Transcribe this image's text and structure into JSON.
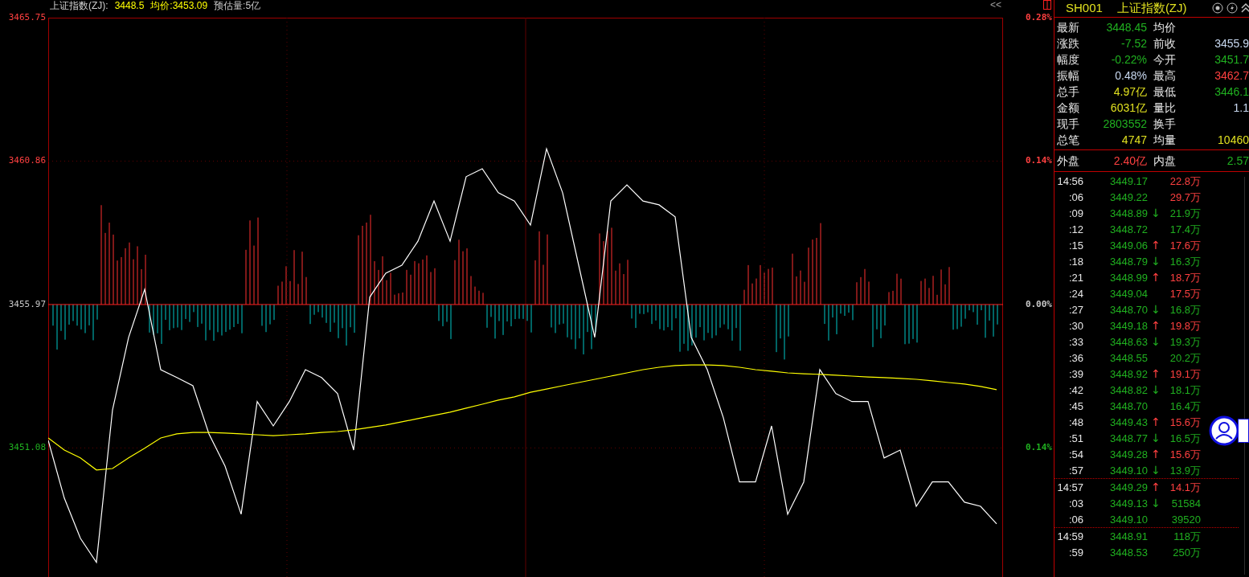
{
  "header": {
    "title": "上证指数(ZJ):",
    "price": "3448.5",
    "average": "均价:3453.09",
    "estimate": "预估量:5亿"
  },
  "collapse_button": "<<",
  "chart": {
    "right_axis": [
      {
        "text": "0.28%",
        "color": "#ff4040"
      },
      {
        "text": "0.14%",
        "color": "#ff4040"
      },
      {
        "text": "0.00%",
        "color": "#c8c8c8"
      },
      {
        "text": "0.14%",
        "color": "#20b020"
      }
    ],
    "chart_data": {
      "type": "line",
      "ylim": [
        3446.68,
        3465.75
      ],
      "grid": true,
      "ref_lines": [
        {
          "axis": "y",
          "value": 3455.97,
          "color": "#ff2020"
        }
      ],
      "categories": [
        null,
        null,
        null,
        null,
        null,
        null,
        null,
        null,
        null,
        null,
        null,
        null,
        null,
        null,
        null,
        null,
        null,
        null,
        null,
        null,
        null,
        null,
        null,
        null,
        null,
        null,
        null,
        null,
        null,
        null,
        null,
        null,
        null,
        null,
        null,
        null,
        null,
        null,
        null,
        null,
        null,
        null,
        null,
        null,
        null,
        null,
        null,
        null,
        null,
        null,
        null,
        null,
        null,
        null,
        null,
        null,
        null,
        null,
        null,
        null
      ],
      "yticks": [
        {
          "value": 3465.75,
          "label": "3465.75"
        },
        {
          "value": 3460.86,
          "label": "3460.86"
        },
        {
          "value": 3455.97,
          "label": "3455.97"
        },
        {
          "value": 3451.08,
          "label": "3451.08"
        }
      ],
      "series": [
        {
          "color": "#ffffff",
          "values": [
            3451.34,
            3449.37,
            3448.0,
            3447.18,
            3452.38,
            3454.85,
            3456.49,
            3453.75,
            3453.48,
            3453.2,
            3451.56,
            3450.46,
            3448.82,
            3452.66,
            3451.83,
            3452.66,
            3453.75,
            3453.48,
            3452.93,
            3451.01,
            3456.22,
            3457.04,
            3457.31,
            3458.13,
            3459.5,
            3458.13,
            3460.33,
            3460.6,
            3459.78,
            3459.5,
            3458.68,
            3461.28,
            3459.78,
            3457.31,
            3454.85,
            3459.5,
            3460.05,
            3459.5,
            3459.37,
            3458.96,
            3454.85,
            3453.75,
            3452.11,
            3449.92,
            3449.92,
            3451.83,
            3448.82,
            3449.92,
            3453.75,
            3452.93,
            3452.66,
            3452.66,
            3450.74,
            3451.01,
            3449.09,
            3449.92,
            3449.92,
            3449.23,
            3449.09,
            3448.49
          ]
        },
        {
          "color": "#ffff00",
          "values": [
            3451.42,
            3451.01,
            3450.74,
            3450.33,
            3450.38,
            3450.74,
            3451.07,
            3451.42,
            3451.56,
            3451.61,
            3451.61,
            3451.59,
            3451.56,
            3451.53,
            3451.5,
            3451.53,
            3451.56,
            3451.61,
            3451.64,
            3451.7,
            3451.78,
            3451.86,
            3451.97,
            3452.08,
            3452.19,
            3452.3,
            3452.44,
            3452.57,
            3452.71,
            3452.82,
            3452.98,
            3453.09,
            3453.2,
            3453.31,
            3453.42,
            3453.53,
            3453.64,
            3453.75,
            3453.83,
            3453.89,
            3453.91,
            3453.91,
            3453.89,
            3453.83,
            3453.75,
            3453.7,
            3453.64,
            3453.61,
            3453.59,
            3453.56,
            3453.53,
            3453.5,
            3453.48,
            3453.45,
            3453.42,
            3453.37,
            3453.31,
            3453.26,
            3453.18,
            3453.07
          ]
        }
      ]
    }
  },
  "panel": {
    "code": "SH001",
    "name": "上证指数(ZJ)",
    "quote": [
      {
        "left": {
          "label": "最新",
          "value": "3448.45",
          "color": "#20b020"
        },
        "right": {
          "label": "均价"
        }
      },
      {
        "left": {
          "label": "涨跌",
          "value": "-7.52",
          "color": "#20b020"
        },
        "right": {
          "label": "前收",
          "value": "3455.9",
          "color": "#c8d8f0"
        }
      },
      {
        "left": {
          "label": "幅度",
          "value": "-0.22%",
          "color": "#20b020"
        },
        "right": {
          "label": "今开",
          "value": "3451.7",
          "color": "#20b020"
        }
      },
      {
        "left": {
          "label": "振幅",
          "value": "0.48%",
          "color": "#c8d8f0"
        },
        "right": {
          "label": "最高",
          "value": "3462.7",
          "color": "#ff4040"
        }
      },
      {
        "left": {
          "label": "总手",
          "value": "4.97亿",
          "color": "#e0e020"
        },
        "right": {
          "label": "最低",
          "value": "3446.1",
          "color": "#20b020"
        }
      },
      {
        "left": {
          "label": "金额",
          "value": "6031亿",
          "color": "#e0e020"
        },
        "right": {
          "label": "量比",
          "value": "1.1",
          "color": "#c8d8f0"
        }
      },
      {
        "left": {
          "label": "现手",
          "value": "2803552",
          "color": "#20b020"
        },
        "right": {
          "label": "换手"
        }
      },
      {
        "left": {
          "label": "总笔",
          "value": "4747",
          "color": "#e0e020"
        },
        "right": {
          "label": "均量",
          "value": "10460",
          "color": "#e0e020"
        }
      }
    ],
    "balance": {
      "left": {
        "label": "外盘",
        "value": "2.40亿",
        "color": "#ff4040"
      },
      "right": {
        "label": "内盘",
        "value": "2.57",
        "color": "#20b020"
      }
    },
    "tick_groups": [
      {
        "rows": [
          {
            "time": "14:56",
            "price": "3449.17",
            "kind": "plain",
            "volume": "22.8万",
            "color": "#ff4040"
          },
          {
            "time": ":06",
            "price": "3449.22",
            "kind": "plain",
            "volume": "29.7万",
            "color": "#ff4040"
          },
          {
            "time": ":09",
            "price": "3448.89",
            "arrow": "↓",
            "kind": "down",
            "volume": "21.9万",
            "color": "#20b020"
          },
          {
            "time": ":12",
            "price": "3448.72",
            "kind": "plain",
            "volume": "17.4万",
            "color": "#20b020"
          },
          {
            "time": ":15",
            "price": "3449.06",
            "arrow": "↑",
            "kind": "up",
            "volume": "17.6万",
            "color": "#ff4040"
          },
          {
            "time": ":18",
            "price": "3448.79",
            "arrow": "↓",
            "kind": "down",
            "volume": "16.3万",
            "color": "#20b020"
          },
          {
            "time": ":21",
            "price": "3448.99",
            "arrow": "↑",
            "kind": "up",
            "volume": "18.7万",
            "color": "#ff4040"
          },
          {
            "time": ":24",
            "price": "3449.04",
            "kind": "plain",
            "volume": "17.5万",
            "color": "#ff4040"
          },
          {
            "time": ":27",
            "price": "3448.70",
            "arrow": "↓",
            "kind": "down",
            "volume": "16.8万",
            "color": "#20b020"
          },
          {
            "time": ":30",
            "price": "3449.18",
            "arrow": "↑",
            "kind": "up",
            "volume": "19.8万",
            "color": "#ff4040"
          },
          {
            "time": ":33",
            "price": "3448.63",
            "arrow": "↓",
            "kind": "down",
            "volume": "19.3万",
            "color": "#20b020"
          },
          {
            "time": ":36",
            "price": "3448.55",
            "kind": "plain",
            "volume": "20.2万",
            "color": "#20b020"
          },
          {
            "time": ":39",
            "price": "3448.92",
            "arrow": "↑",
            "kind": "up",
            "volume": "19.1万",
            "color": "#ff4040"
          },
          {
            "time": ":42",
            "price": "3448.82",
            "arrow": "↓",
            "kind": "down",
            "volume": "18.1万",
            "color": "#20b020"
          },
          {
            "time": ":45",
            "price": "3448.70",
            "kind": "plain",
            "volume": "16.4万",
            "color": "#20b020"
          },
          {
            "time": ":48",
            "price": "3449.43",
            "arrow": "↑",
            "kind": "up",
            "volume": "15.6万",
            "color": "#ff4040"
          },
          {
            "time": ":51",
            "price": "3448.77",
            "arrow": "↓",
            "kind": "down",
            "volume": "16.5万",
            "color": "#20b020"
          },
          {
            "time": ":54",
            "price": "3449.28",
            "arrow": "↑",
            "kind": "up",
            "volume": "15.6万",
            "color": "#ff4040"
          },
          {
            "time": ":57",
            "price": "3449.10",
            "arrow": "↓",
            "kind": "down",
            "volume": "13.9万",
            "color": "#20b020"
          }
        ]
      },
      {
        "rows": [
          {
            "time": "14:57",
            "price": "3449.29",
            "arrow": "↑",
            "kind": "up",
            "volume": "14.1万",
            "color": "#ff4040"
          },
          {
            "time": ":03",
            "price": "3449.13",
            "arrow": "↓",
            "kind": "down",
            "volume": "51584",
            "color": "#20b020"
          },
          {
            "time": ":06",
            "price": "3449.10",
            "kind": "plain",
            "volume": "39520",
            "color": "#20b020"
          }
        ]
      },
      {
        "rows": [
          {
            "time": "14:59",
            "price": "3448.91",
            "kind": "plain",
            "volume": "118万",
            "color": "#20b020"
          },
          {
            "time": ":59",
            "price": "3448.53",
            "kind": "plain",
            "volume": "250万",
            "color": "#20b020"
          }
        ]
      }
    ]
  }
}
